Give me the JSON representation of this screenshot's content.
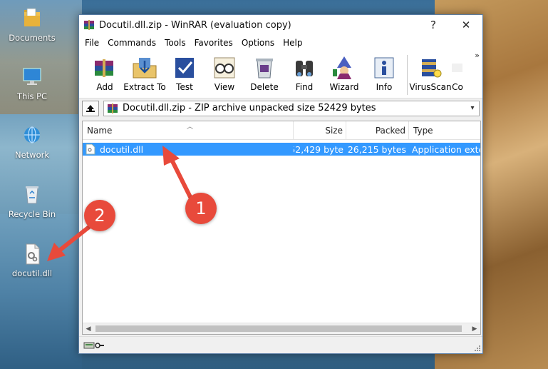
{
  "desktop": {
    "icons": [
      {
        "label": "Documents",
        "icon": "folder-documents-icon"
      },
      {
        "label": "This PC",
        "icon": "computer-icon"
      },
      {
        "label": "Network",
        "icon": "network-icon"
      },
      {
        "label": "Recycle Bin",
        "icon": "recycle-bin-icon"
      },
      {
        "label": "docutil.dll",
        "icon": "dll-file-icon"
      }
    ]
  },
  "window": {
    "title": "Docutil.dll.zip - WinRAR (evaluation copy)",
    "help_btn": "?",
    "close_btn": "✕"
  },
  "menu": [
    "File",
    "Commands",
    "Tools",
    "Favorites",
    "Options",
    "Help"
  ],
  "toolbar": {
    "buttons": [
      {
        "label": "Add",
        "icon": "add-archive-icon"
      },
      {
        "label": "Extract To",
        "icon": "extract-folder-icon"
      },
      {
        "label": "Test",
        "icon": "test-archive-icon"
      },
      {
        "label": "View",
        "icon": "view-glasses-icon"
      },
      {
        "label": "Delete",
        "icon": "delete-recycle-icon"
      },
      {
        "label": "Find",
        "icon": "find-binoculars-icon"
      },
      {
        "label": "Wizard",
        "icon": "wizard-icon"
      },
      {
        "label": "Info",
        "icon": "info-icon"
      },
      {
        "label": "VirusScan",
        "icon": "virus-scan-icon"
      },
      {
        "label": "Co",
        "icon": "comment-icon"
      }
    ],
    "more": "»"
  },
  "address": {
    "text": "Docutil.dll.zip - ZIP archive unpacked size 52429 bytes"
  },
  "list": {
    "columns": [
      "Name",
      "Size",
      "Packed",
      "Type"
    ],
    "rows": [
      {
        "name": "docutil.dll",
        "size": "52,429 byte",
        "packed": "26,215 bytes",
        "type": "Application exter"
      }
    ]
  },
  "annotations": {
    "badge1": "1",
    "badge2": "2",
    "color": "#e84a3b"
  },
  "colors": {
    "selection": "#3399ff",
    "accent": "#e84a3b"
  }
}
